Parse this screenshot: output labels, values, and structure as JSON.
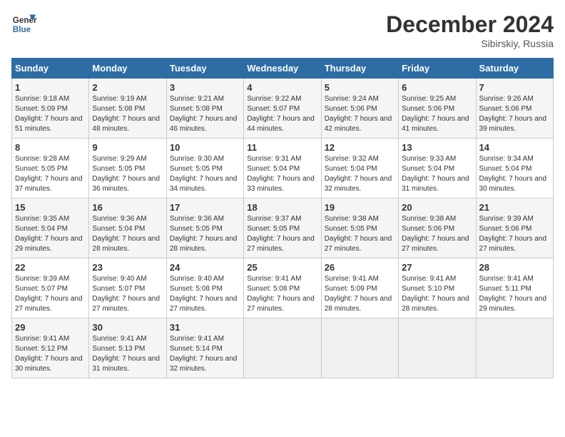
{
  "header": {
    "logo_line1": "General",
    "logo_line2": "Blue",
    "month": "December 2024",
    "location": "Sibirskiy, Russia"
  },
  "weekdays": [
    "Sunday",
    "Monday",
    "Tuesday",
    "Wednesday",
    "Thursday",
    "Friday",
    "Saturday"
  ],
  "weeks": [
    [
      {
        "day": "1",
        "sunrise": "9:18 AM",
        "sunset": "5:09 PM",
        "daylight": "7 hours and 51 minutes."
      },
      {
        "day": "2",
        "sunrise": "9:19 AM",
        "sunset": "5:08 PM",
        "daylight": "7 hours and 48 minutes."
      },
      {
        "day": "3",
        "sunrise": "9:21 AM",
        "sunset": "5:08 PM",
        "daylight": "7 hours and 46 minutes."
      },
      {
        "day": "4",
        "sunrise": "9:22 AM",
        "sunset": "5:07 PM",
        "daylight": "7 hours and 44 minutes."
      },
      {
        "day": "5",
        "sunrise": "9:24 AM",
        "sunset": "5:06 PM",
        "daylight": "7 hours and 42 minutes."
      },
      {
        "day": "6",
        "sunrise": "9:25 AM",
        "sunset": "5:06 PM",
        "daylight": "7 hours and 41 minutes."
      },
      {
        "day": "7",
        "sunrise": "9:26 AM",
        "sunset": "5:06 PM",
        "daylight": "7 hours and 39 minutes."
      }
    ],
    [
      {
        "day": "8",
        "sunrise": "9:28 AM",
        "sunset": "5:05 PM",
        "daylight": "7 hours and 37 minutes."
      },
      {
        "day": "9",
        "sunrise": "9:29 AM",
        "sunset": "5:05 PM",
        "daylight": "7 hours and 36 minutes."
      },
      {
        "day": "10",
        "sunrise": "9:30 AM",
        "sunset": "5:05 PM",
        "daylight": "7 hours and 34 minutes."
      },
      {
        "day": "11",
        "sunrise": "9:31 AM",
        "sunset": "5:04 PM",
        "daylight": "7 hours and 33 minutes."
      },
      {
        "day": "12",
        "sunrise": "9:32 AM",
        "sunset": "5:04 PM",
        "daylight": "7 hours and 32 minutes."
      },
      {
        "day": "13",
        "sunrise": "9:33 AM",
        "sunset": "5:04 PM",
        "daylight": "7 hours and 31 minutes."
      },
      {
        "day": "14",
        "sunrise": "9:34 AM",
        "sunset": "5:04 PM",
        "daylight": "7 hours and 30 minutes."
      }
    ],
    [
      {
        "day": "15",
        "sunrise": "9:35 AM",
        "sunset": "5:04 PM",
        "daylight": "7 hours and 29 minutes."
      },
      {
        "day": "16",
        "sunrise": "9:36 AM",
        "sunset": "5:04 PM",
        "daylight": "7 hours and 28 minutes."
      },
      {
        "day": "17",
        "sunrise": "9:36 AM",
        "sunset": "5:05 PM",
        "daylight": "7 hours and 28 minutes."
      },
      {
        "day": "18",
        "sunrise": "9:37 AM",
        "sunset": "5:05 PM",
        "daylight": "7 hours and 27 minutes."
      },
      {
        "day": "19",
        "sunrise": "9:38 AM",
        "sunset": "5:05 PM",
        "daylight": "7 hours and 27 minutes."
      },
      {
        "day": "20",
        "sunrise": "9:38 AM",
        "sunset": "5:06 PM",
        "daylight": "7 hours and 27 minutes."
      },
      {
        "day": "21",
        "sunrise": "9:39 AM",
        "sunset": "5:06 PM",
        "daylight": "7 hours and 27 minutes."
      }
    ],
    [
      {
        "day": "22",
        "sunrise": "9:39 AM",
        "sunset": "5:07 PM",
        "daylight": "7 hours and 27 minutes."
      },
      {
        "day": "23",
        "sunrise": "9:40 AM",
        "sunset": "5:07 PM",
        "daylight": "7 hours and 27 minutes."
      },
      {
        "day": "24",
        "sunrise": "9:40 AM",
        "sunset": "5:08 PM",
        "daylight": "7 hours and 27 minutes."
      },
      {
        "day": "25",
        "sunrise": "9:41 AM",
        "sunset": "5:08 PM",
        "daylight": "7 hours and 27 minutes."
      },
      {
        "day": "26",
        "sunrise": "9:41 AM",
        "sunset": "5:09 PM",
        "daylight": "7 hours and 28 minutes."
      },
      {
        "day": "27",
        "sunrise": "9:41 AM",
        "sunset": "5:10 PM",
        "daylight": "7 hours and 28 minutes."
      },
      {
        "day": "28",
        "sunrise": "9:41 AM",
        "sunset": "5:11 PM",
        "daylight": "7 hours and 29 minutes."
      }
    ],
    [
      {
        "day": "29",
        "sunrise": "9:41 AM",
        "sunset": "5:12 PM",
        "daylight": "7 hours and 30 minutes."
      },
      {
        "day": "30",
        "sunrise": "9:41 AM",
        "sunset": "5:13 PM",
        "daylight": "7 hours and 31 minutes."
      },
      {
        "day": "31",
        "sunrise": "9:41 AM",
        "sunset": "5:14 PM",
        "daylight": "7 hours and 32 minutes."
      },
      null,
      null,
      null,
      null
    ]
  ]
}
